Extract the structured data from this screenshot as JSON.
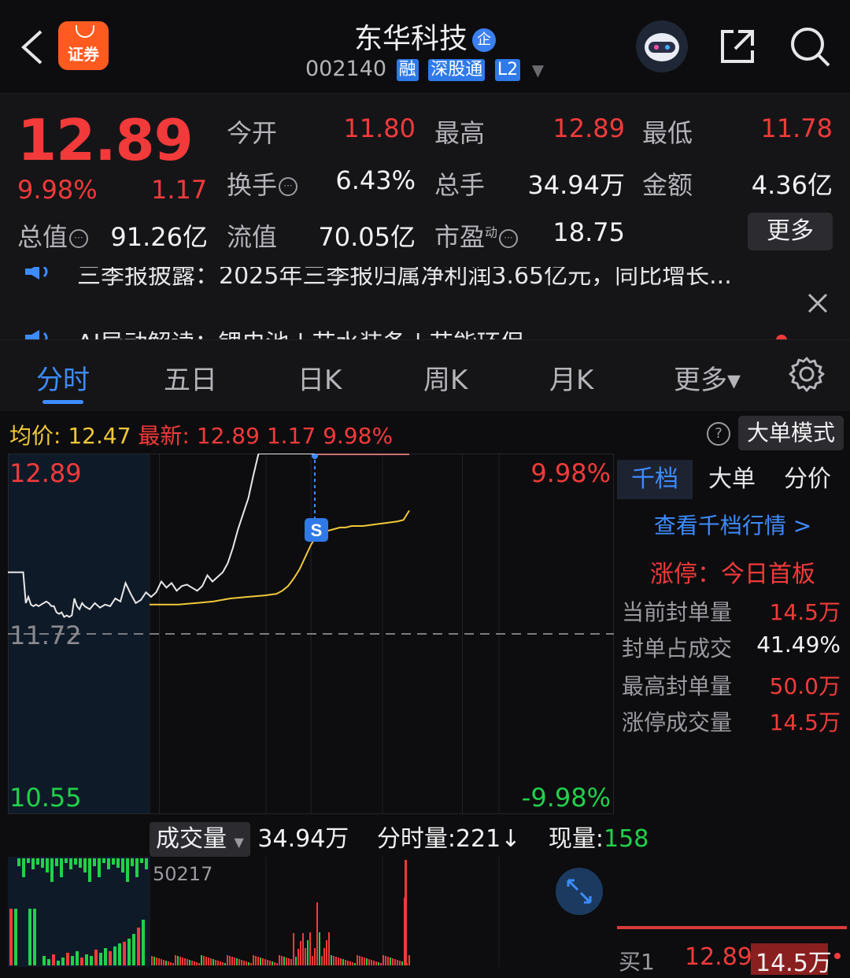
{
  "header": {
    "app_logo_text": "证券",
    "title": "东华科技",
    "title_badge": "企",
    "code": "002140",
    "tags": [
      "融",
      "深股通",
      "L2"
    ]
  },
  "quote": {
    "price": "12.89",
    "change_pct": "9.98%",
    "change": "1.17",
    "fields": {
      "open_label": "今开",
      "open": "11.80",
      "high_label": "最高",
      "high": "12.89",
      "low_label": "最低",
      "low": "11.78",
      "turnover_label": "换手",
      "turnover": "6.43%",
      "volume_label": "总手",
      "volume": "34.94万",
      "amount_label": "金额",
      "amount": "4.36亿",
      "mktcap_label": "总值",
      "mktcap": "91.26亿",
      "float_label": "流值",
      "float": "70.05亿",
      "pe_label": "市盈",
      "pe_sup": "动",
      "pe": "18.75"
    },
    "more_button": "更多"
  },
  "news": {
    "line1": "三季报披露：2025年三季报归属净利润3.65亿元，同比增长...",
    "line2": "AI异动解读：锂电池 | 节水装备 | 节能环保"
  },
  "tabs": [
    "分时",
    "五日",
    "日K",
    "周K",
    "月K",
    "更多▾"
  ],
  "avg_row": {
    "avg_label": "均价:",
    "avg_value": "12.47",
    "latest_label": "最新:",
    "latest_value": "12.89",
    "latest_change": "1.17",
    "latest_pct": "9.98%",
    "help_icon": "?",
    "mode_button": "大单模式"
  },
  "chart_axes": {
    "top_price": "12.89",
    "mid_price": "11.72",
    "bottom_price": "10.55",
    "top_pct": "9.98%",
    "bottom_pct": "-9.98%"
  },
  "chart_data": {
    "type": "line",
    "ylim": [
      10.55,
      12.89
    ],
    "prev_close": 11.72,
    "sessions_minutes": 240,
    "series": [
      {
        "name": "price",
        "color": "#e8e8e8",
        "x": [
          0,
          6,
          7,
          8,
          9,
          10,
          11,
          12,
          13,
          14,
          15,
          16,
          17,
          18,
          19,
          20,
          21,
          22,
          23,
          24,
          25,
          26,
          27,
          28,
          29,
          30,
          32,
          34,
          36,
          38,
          40,
          42,
          44,
          46,
          48,
          50,
          52,
          54,
          56,
          58,
          60,
          62,
          64,
          66,
          68,
          70,
          72,
          74,
          76,
          78,
          80,
          82,
          84,
          86,
          88,
          90,
          92,
          94,
          96,
          98,
          100,
          102,
          104,
          106,
          108,
          110,
          112,
          114,
          116,
          118,
          120
        ],
        "y": [
          12.12,
          12.12,
          11.92,
          11.96,
          11.91,
          11.9,
          11.91,
          11.9,
          11.91,
          11.92,
          11.93,
          11.92,
          11.9,
          11.9,
          11.86,
          11.85,
          11.86,
          11.83,
          11.84,
          11.83,
          11.84,
          11.95,
          11.9,
          11.88,
          11.92,
          11.9,
          11.88,
          11.92,
          11.89,
          11.91,
          11.9,
          11.95,
          11.93,
          12.05,
          11.98,
          11.92,
          11.94,
          11.99,
          11.96,
          11.99,
          12.06,
          12.02,
          12.05,
          12.0,
          12.03,
          12.04,
          12.02,
          12.0,
          12.03,
          12.1,
          12.06,
          12.09,
          12.12,
          12.18,
          12.28,
          12.4,
          12.5,
          12.6,
          12.75,
          12.89,
          12.89,
          12.89,
          12.89,
          12.89,
          12.89,
          12.89,
          12.89,
          12.89,
          12.89,
          12.89,
          12.89
        ]
      },
      {
        "name": "avg",
        "color": "#f0c83a",
        "x": [
          30,
          34,
          40,
          46,
          52,
          58,
          64,
          70,
          74,
          76,
          78,
          80,
          82,
          84,
          86,
          88,
          90,
          92,
          94,
          96,
          98,
          100,
          104,
          108,
          112,
          116,
          118,
          120
        ],
        "y": [
          11.91,
          11.91,
          11.91,
          11.92,
          11.93,
          11.95,
          11.96,
          11.97,
          11.98,
          12.0,
          12.03,
          12.08,
          12.14,
          12.22,
          12.3,
          12.36,
          12.38,
          12.39,
          12.4,
          12.41,
          12.41,
          12.42,
          12.42,
          12.43,
          12.44,
          12.45,
          12.46,
          12.52
        ]
      }
    ]
  },
  "right_panel": {
    "tabs": [
      "千档",
      "大单",
      "分价"
    ],
    "view_link": "查看千档行情 >",
    "limit_status": "涨停：今日首板",
    "rows": [
      {
        "label": "当前封单量",
        "value": "14.5万",
        "color": "#f23a3a"
      },
      {
        "label": "封单占成交",
        "value": "41.49%",
        "color": "#f2f2f3"
      },
      {
        "label": "最高封单量",
        "value": "50.0万",
        "color": "#f23a3a"
      },
      {
        "label": "涨停成交量",
        "value": "14.5万",
        "color": "#f23a3a"
      }
    ],
    "buy1_label": "买1",
    "buy1_price": "12.89",
    "buy1_volume": "14.5万"
  },
  "volume": {
    "dropdown": "成交量",
    "total": "34.94万",
    "minute_label": "分时量:221↓",
    "current_label": "现量:",
    "current_value": "158",
    "max_label": "50217"
  }
}
